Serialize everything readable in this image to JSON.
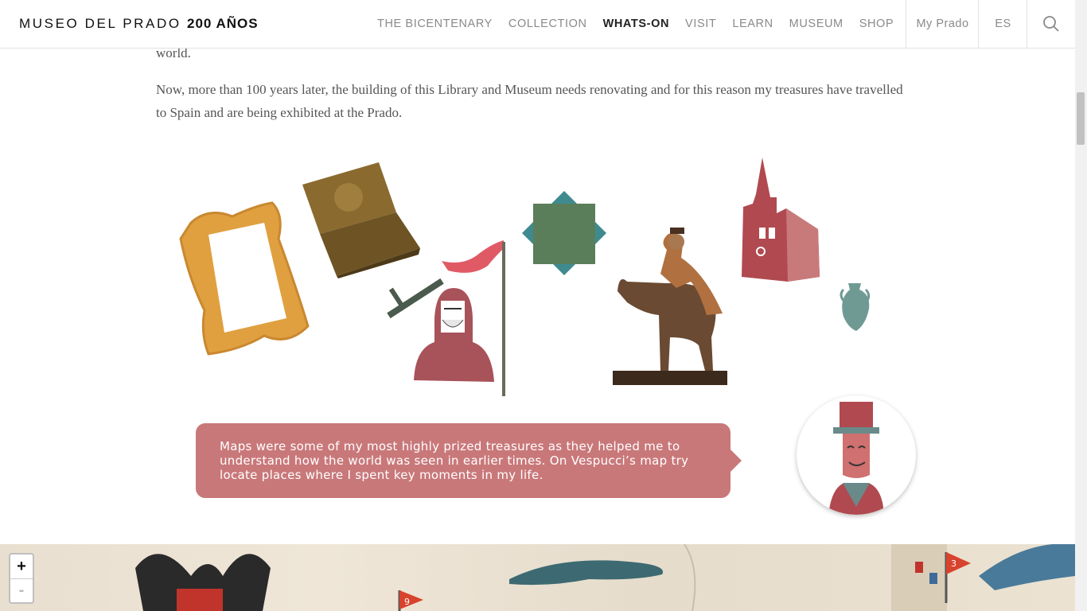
{
  "header": {
    "logo_main": "MUSEO DEL PRADO",
    "logo_years": "200 AÑOS",
    "nav": [
      "THE BICENTENARY",
      "COLLECTION",
      "WHATS-ON",
      "VISIT",
      "LEARN",
      "MUSEUM",
      "SHOP"
    ],
    "active_nav": "WHATS-ON",
    "my_prado": "My Prado",
    "language": "ES",
    "search_icon": "search-icon"
  },
  "content": {
    "paragraph_top_fragment": "world.",
    "paragraph_main": "Now, more than 100 years later, the building of this Library and Museum needs renovating and for this reason my treasures have travelled to Spain and are being exhibited at the Prado."
  },
  "illustrations": [
    "frame",
    "chest",
    "sword",
    "knight",
    "banner",
    "green-square",
    "equestrian-statue",
    "church",
    "vase"
  ],
  "bubble": {
    "text": "Maps were some of my most highly prized treasures as they helped me to understand how the world was seen in earlier times. On Vespucci’s map try locate places where I spent key moments in my life."
  },
  "map": {
    "zoom_in": "+",
    "zoom_out": "-",
    "flags": [
      "9",
      "3"
    ]
  },
  "colors": {
    "bubble": "#c9787a",
    "flag": "#d8432e"
  }
}
